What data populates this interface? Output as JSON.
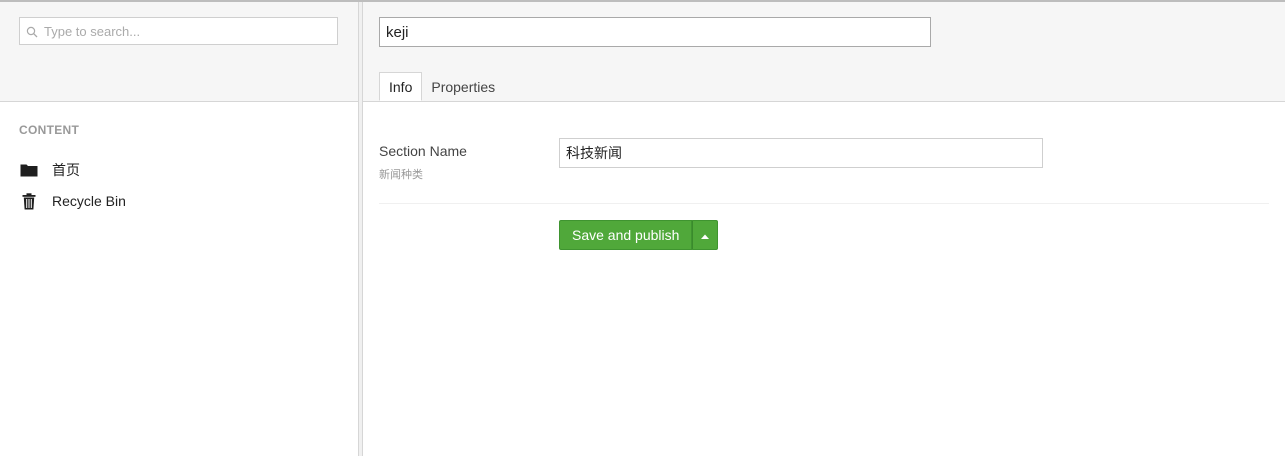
{
  "sidebar": {
    "search": {
      "placeholder": "Type to search..."
    },
    "section_label": "CONTENT",
    "items": [
      {
        "label": "首页",
        "icon": "folder-icon"
      },
      {
        "label": "Recycle Bin",
        "icon": "trash-icon"
      }
    ]
  },
  "editor": {
    "name_value": "keji",
    "tabs": [
      {
        "label": "Info",
        "active": true
      },
      {
        "label": "Properties",
        "active": false
      }
    ],
    "field": {
      "label": "Section Name",
      "description": "新闻种类",
      "value": "科技新闻"
    },
    "save_button": {
      "label": "Save and publish"
    }
  },
  "colors": {
    "accent_green": "#50a83a",
    "header_bg": "#f6f6f6",
    "border": "#d6d6d6"
  }
}
